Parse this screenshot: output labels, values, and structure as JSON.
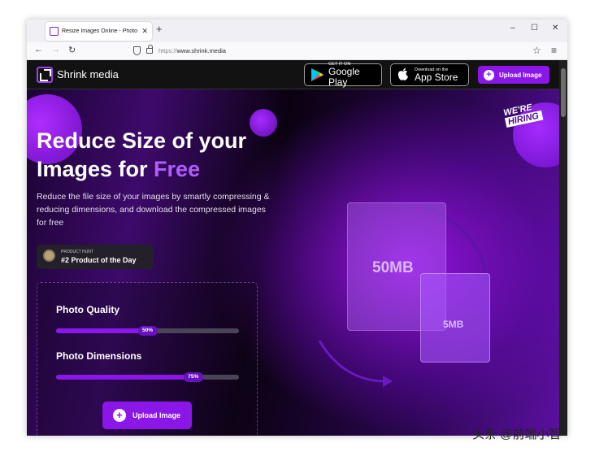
{
  "browser": {
    "tab_title": "Resize Images Online - Photo R",
    "new_tab": "+",
    "url_host": "www.shrink.media",
    "url_scheme": "https://",
    "minimize": "–",
    "maximize": "☐",
    "close": "✕",
    "back": "←",
    "forward": "→",
    "reload": "↻",
    "bookmark": "☆",
    "menu": "≡"
  },
  "site": {
    "brand": "Shrink media",
    "google_play": {
      "small": "GET IT ON",
      "big": "Google Play"
    },
    "app_store": {
      "small": "Download on the",
      "big": "App Store"
    },
    "upload_top": "Upload Image",
    "hiring_line1": "WE'RE",
    "hiring_line2": "HIRING",
    "headline_line1": "Reduce Size of your",
    "headline_line2": "Images for ",
    "headline_free": "Free",
    "subtitle": "Reduce the file size of your images by smartly compressing & reducing dimensions, and download the compressed images for free",
    "product_hunt": {
      "small": "PRODUCT HUNT",
      "big": "#2 Product of the Day"
    },
    "quality": {
      "label": "Photo Quality",
      "value": 50,
      "display": "50%"
    },
    "dimensions": {
      "label": "Photo Dimensions",
      "value": 75,
      "display": "75%"
    },
    "upload_main": "Upload Image",
    "file_large": "50MB",
    "file_small": "5MB"
  },
  "watermark": "头条 @前端小智",
  "colors": {
    "accent": "#8a17e8",
    "accent_light": "#b15cff",
    "page_dark": "#0a0210"
  },
  "icons": [
    "google-play-icon",
    "apple-icon",
    "plus-circle-icon",
    "medal-icon",
    "logo-icon",
    "shield-icon",
    "lock-icon"
  ]
}
